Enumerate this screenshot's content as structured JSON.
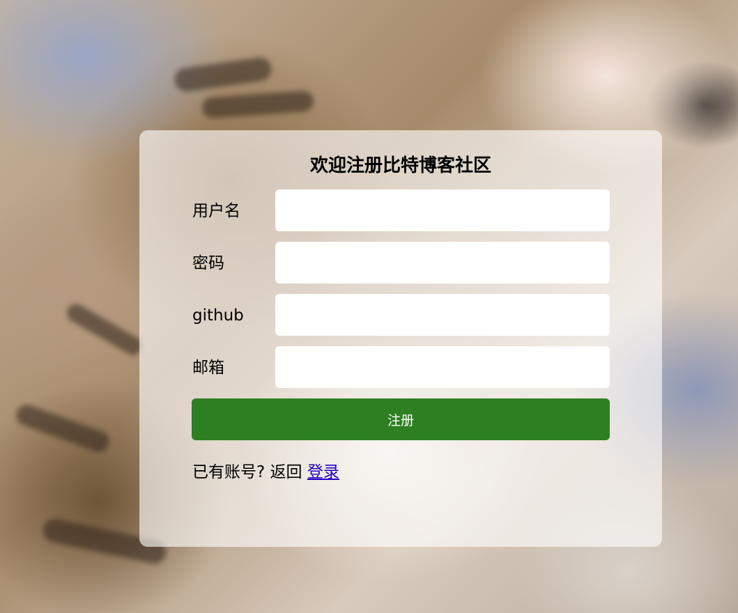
{
  "form": {
    "title": "欢迎注册比特博客社区",
    "fields": [
      {
        "label": "用户名",
        "value": "",
        "placeholder": ""
      },
      {
        "label": "密码",
        "value": "",
        "placeholder": ""
      },
      {
        "label": "github",
        "value": "",
        "placeholder": ""
      },
      {
        "label": "邮箱",
        "value": "",
        "placeholder": ""
      }
    ],
    "submit_label": "注册",
    "footer_prefix": "已有账号? 返回 ",
    "login_link": "登录"
  },
  "colors": {
    "submit_button": "#2e7f22",
    "link": "#2200cc",
    "card_overlay": "rgba(255,255,255,0.62)"
  }
}
